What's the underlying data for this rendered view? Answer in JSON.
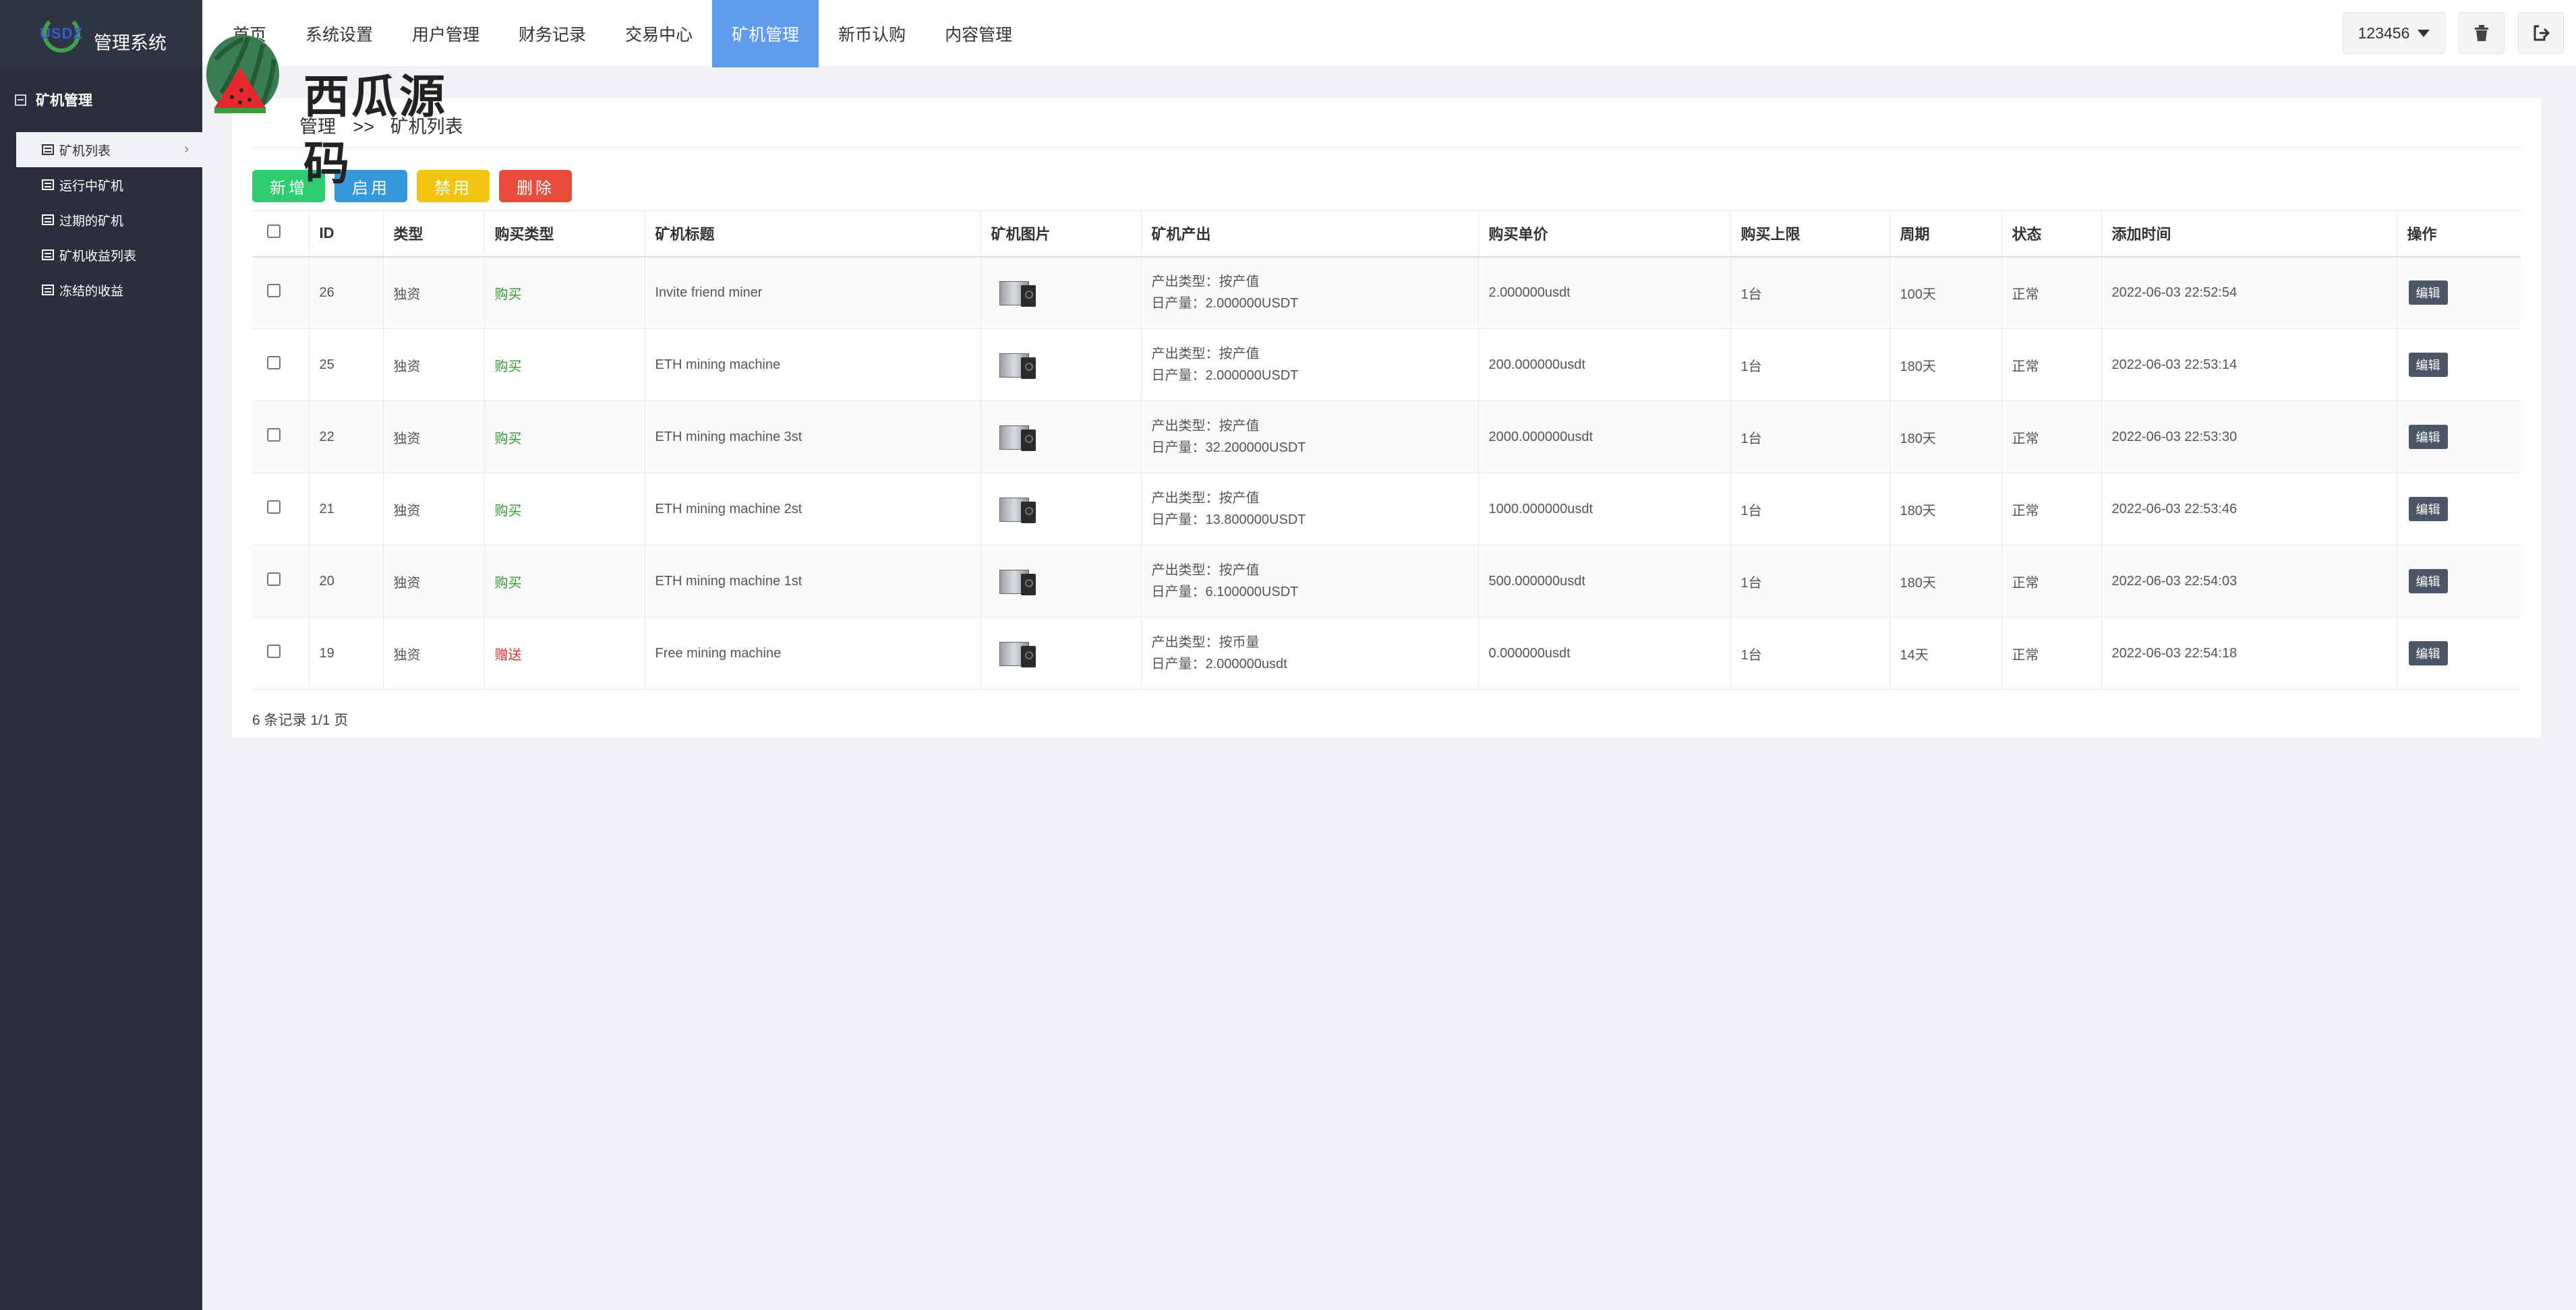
{
  "brand": {
    "logo_text": "USDZ",
    "title": "管理系统"
  },
  "sidebar": {
    "group": "矿机管理",
    "items": [
      {
        "label": "矿机列表",
        "active": true
      },
      {
        "label": "运行中矿机",
        "active": false
      },
      {
        "label": "过期的矿机",
        "active": false
      },
      {
        "label": "矿机收益列表",
        "active": false
      },
      {
        "label": "冻结的收益",
        "active": false
      }
    ]
  },
  "topnav": {
    "items": [
      {
        "label": "首页"
      },
      {
        "label": "系统设置"
      },
      {
        "label": "用户管理"
      },
      {
        "label": "财务记录"
      },
      {
        "label": "交易中心"
      },
      {
        "label": "矿机管理",
        "active": true
      },
      {
        "label": "新币认购"
      },
      {
        "label": "内容管理"
      }
    ],
    "user": "123456",
    "trash_icon": "trash-icon",
    "logout_icon": "logout-icon"
  },
  "watermark": {
    "text": "西瓜源码"
  },
  "breadcrumb": {
    "parent": "管理",
    "separator": ">>",
    "current": "矿机列表"
  },
  "toolbar": {
    "add": "新增",
    "enable": "启用",
    "disable": "禁用",
    "delete": "删除"
  },
  "table": {
    "headers": {
      "id": "ID",
      "type": "类型",
      "buy_type": "购买类型",
      "title": "矿机标题",
      "image": "矿机图片",
      "output": "矿机产出",
      "price": "购买单价",
      "limit": "购买上限",
      "period": "周期",
      "status": "状态",
      "added": "添加时间",
      "action": "操作"
    },
    "rows": [
      {
        "id": "26",
        "type": "独资",
        "buy_type": "购买",
        "buy_kind": "buy",
        "title": "Invite friend miner",
        "output_type": "产出类型：按产值",
        "daily": "日产量：2.000000USDT",
        "price": "2.000000usdt",
        "limit": "1台",
        "period": "100天",
        "status": "正常",
        "added": "2022-06-03 22:52:54",
        "action": "编辑"
      },
      {
        "id": "25",
        "type": "独资",
        "buy_type": "购买",
        "buy_kind": "buy",
        "title": "ETH mining machine",
        "output_type": "产出类型：按产值",
        "daily": "日产量：2.000000USDT",
        "price": "200.000000usdt",
        "limit": "1台",
        "period": "180天",
        "status": "正常",
        "added": "2022-06-03 22:53:14",
        "action": "编辑"
      },
      {
        "id": "22",
        "type": "独资",
        "buy_type": "购买",
        "buy_kind": "buy",
        "title": "ETH mining machine 3st",
        "output_type": "产出类型：按产值",
        "daily": "日产量：32.200000USDT",
        "price": "2000.000000usdt",
        "limit": "1台",
        "period": "180天",
        "status": "正常",
        "added": "2022-06-03 22:53:30",
        "action": "编辑"
      },
      {
        "id": "21",
        "type": "独资",
        "buy_type": "购买",
        "buy_kind": "buy",
        "title": "ETH mining machine 2st",
        "output_type": "产出类型：按产值",
        "daily": "日产量：13.800000USDT",
        "price": "1000.000000usdt",
        "limit": "1台",
        "period": "180天",
        "status": "正常",
        "added": "2022-06-03 22:53:46",
        "action": "编辑"
      },
      {
        "id": "20",
        "type": "独资",
        "buy_type": "购买",
        "buy_kind": "buy",
        "title": "ETH mining machine 1st",
        "output_type": "产出类型：按产值",
        "daily": "日产量：6.100000USDT",
        "price": "500.000000usdt",
        "limit": "1台",
        "period": "180天",
        "status": "正常",
        "added": "2022-06-03 22:54:03",
        "action": "编辑"
      },
      {
        "id": "19",
        "type": "独资",
        "buy_type": "赠送",
        "buy_kind": "gift",
        "title": "Free mining machine",
        "output_type": "产出类型：按币量",
        "daily": "日产量：2.000000usdt",
        "price": "0.000000usdt",
        "limit": "1台",
        "period": "14天",
        "status": "正常",
        "added": "2022-06-03 22:54:18",
        "action": "编辑"
      }
    ]
  },
  "pager": {
    "text": "6 条记录 1/1 页"
  },
  "colors": {
    "nav_active": "#5f9cec",
    "sidebar_bg": "#2b2f3b",
    "buy": "#2e9a2e",
    "gift": "#e03131"
  }
}
